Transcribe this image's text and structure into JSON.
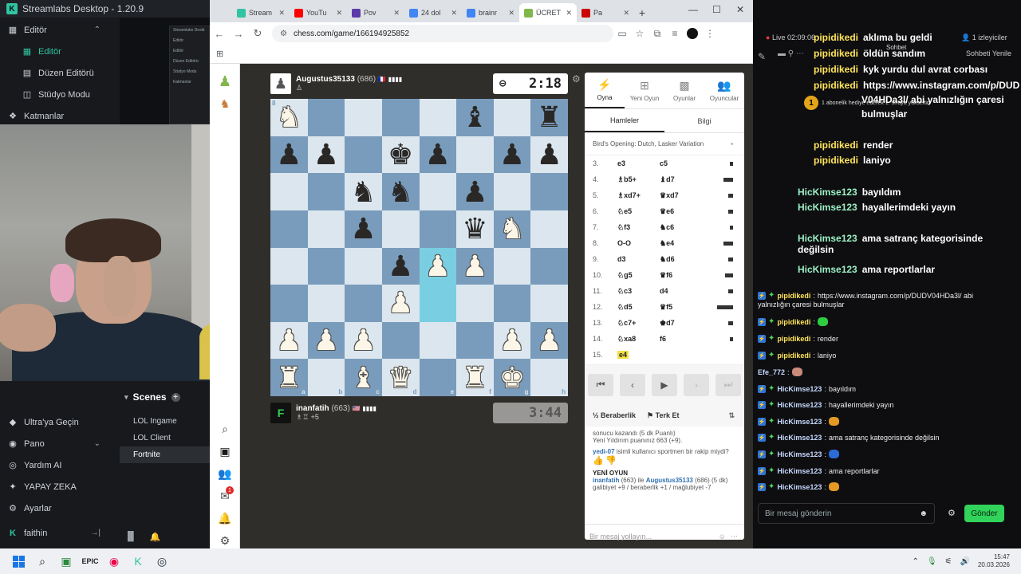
{
  "streamlabs": {
    "title": "Streamlabs Desktop - 1.20.9",
    "nav": [
      {
        "label": "Editör",
        "icon": "grid-icon",
        "section": true
      },
      {
        "label": "Editör",
        "icon": "editor-icon",
        "active": true
      },
      {
        "label": "Düzen Editörü",
        "icon": "layout-icon"
      },
      {
        "label": "Stüdyo Modu",
        "icon": "studio-icon"
      },
      {
        "label": "Katmanlar",
        "icon": "layers-icon",
        "section": true
      }
    ],
    "bottom_nav": [
      {
        "label": "Ultra'ya Geçin",
        "icon": "diamond-icon"
      },
      {
        "label": "Pano",
        "icon": "dashboard-icon"
      },
      {
        "label": "Yardım AI",
        "icon": "help-icon"
      },
      {
        "label": "YAPAY ZEKA",
        "icon": "ai-icon"
      },
      {
        "label": "Ayarlar",
        "icon": "gear-icon"
      },
      {
        "label": "faithin",
        "icon": "user-icon"
      }
    ],
    "mini_editor": [
      "Streamlabs Deskt",
      "Editör",
      "Editör",
      "Düzen Editörü",
      "Stüdyo Modu",
      "Katmanlar"
    ],
    "scenes_title": "Scenes",
    "scenes": [
      "LOL Ingame",
      "LOL Client",
      "Fortnite"
    ],
    "selected_scene": "Fortnite"
  },
  "chrome": {
    "tabs": [
      {
        "title": "Stream",
        "color": "#31c3a2"
      },
      {
        "title": "YouTu",
        "color": "#ff0000"
      },
      {
        "title": "Pov",
        "color": "#5a3aa8"
      },
      {
        "title": "24 dol",
        "color": "#4285f4"
      },
      {
        "title": "brainr",
        "color": "#4285f4"
      },
      {
        "title": "ÜCRET",
        "color": "#81b64c",
        "active": true
      },
      {
        "title": "Pa",
        "color": "#c00"
      }
    ],
    "url": "chess.com/game/166194925852"
  },
  "chess": {
    "top_player": {
      "name": "Augustus35133",
      "rating": "(686)",
      "flag": "🇫🇷",
      "clock": "2:18"
    },
    "bottom_player": {
      "name": "inanfatih",
      "rating": "(663)",
      "flag": "🇺🇸",
      "material": "+5",
      "clock": "3:44"
    },
    "board": [
      [
        "wN",
        "",
        "",
        "",
        "",
        "bB",
        "",
        "bR"
      ],
      [
        "bP",
        "bP",
        "",
        "bK",
        "bP",
        "",
        "bP",
        "bP"
      ],
      [
        "",
        "",
        "bN",
        "bN",
        "",
        "bP",
        "",
        ""
      ],
      [
        "",
        "",
        "bP",
        "",
        "",
        "bQ",
        "wN",
        ""
      ],
      [
        "",
        "",
        "",
        "bP",
        "wP",
        "wP",
        "",
        ""
      ],
      [
        "",
        "",
        "",
        "wP",
        "",
        "",
        "",
        ""
      ],
      [
        "wP",
        "wP",
        "wP",
        "",
        "",
        "",
        "wP",
        "wP"
      ],
      [
        "wR",
        "",
        "wB",
        "wQ",
        "",
        "wR",
        "wK",
        ""
      ]
    ],
    "highlight": [
      [
        4,
        4
      ],
      [
        5,
        4
      ]
    ],
    "files": [
      "a",
      "b",
      "c",
      "d",
      "e",
      "f",
      "g",
      "h"
    ],
    "rank_label": "8",
    "side_tabs": [
      {
        "label": "Oyna",
        "icon": "bolt-icon",
        "active": true
      },
      {
        "label": "Yeni Oyun",
        "icon": "plus-icon"
      },
      {
        "label": "Oyunlar",
        "icon": "board-icon"
      },
      {
        "label": "Oyuncular",
        "icon": "players-icon"
      }
    ],
    "sub_tabs": [
      "Hamleler",
      "Bilgi"
    ],
    "opening": "Bird's Opening: Dutch, Lasker Variation",
    "moves": [
      {
        "n": "3.",
        "w": "e3",
        "b": "c5",
        "bar": 4
      },
      {
        "n": "4.",
        "w": "♗b5+",
        "b": "♝d7",
        "bar": 12
      },
      {
        "n": "5.",
        "w": "♗xd7+",
        "b": "♛xd7",
        "bar": 6
      },
      {
        "n": "6.",
        "w": "♘e5",
        "b": "♛e6",
        "bar": 6
      },
      {
        "n": "7.",
        "w": "♘f3",
        "b": "♞c6",
        "bar": 4
      },
      {
        "n": "8.",
        "w": "O-O",
        "b": "♞e4",
        "bar": 12
      },
      {
        "n": "9.",
        "w": "d3",
        "b": "♞d6",
        "bar": 6
      },
      {
        "n": "10.",
        "w": "♘g5",
        "b": "♛f6",
        "bar": 10
      },
      {
        "n": "11.",
        "w": "♘c3",
        "b": "d4",
        "bar": 6
      },
      {
        "n": "12.",
        "w": "♘d5",
        "b": "♛f5",
        "bar": 20
      },
      {
        "n": "13.",
        "w": "♘c7+",
        "b": "♚d7",
        "bar": 6
      },
      {
        "n": "14.",
        "w": "♘xa8",
        "b": "f6",
        "bar": 4
      },
      {
        "n": "15.",
        "w": "e4",
        "b": "",
        "bar": 0
      }
    ],
    "actions": {
      "draw": "Beraberlik",
      "resign": "Terk Et"
    },
    "chat_log": {
      "line1": "sonucu kazandı (5 dk Puanlı)",
      "line2": "Yeni Yıldırım puanınız 663 (+9).",
      "sportsman_user": "yedi-07",
      "sportsman_text": "isimli kullanıcı sportmen bir rakip miydi?",
      "new_game": "YENİ OYUN",
      "ng_p1": "inanfatih",
      "ng_mid": "(663) ile",
      "ng_p2": "Augustus35133",
      "ng_tail": "(686) (5 dk)",
      "record": "galibiyet +9 / beraberlik +1 / mağlubiyet -7"
    },
    "chat_placeholder": "Bir mesaj yollayın..."
  },
  "stream_chat": {
    "live": "Live 02:09:06",
    "viewers": "1 izleyiciler",
    "chat_title": "Sohbet",
    "refresh": "Sohbeti Yenile",
    "sub_banner": "1 abonelik hediye ederek 1. sıraya yükseltin",
    "big_msgs": [
      {
        "name": "pipidikedi",
        "text": "aklıma bu geldi"
      },
      {
        "name": "pipidikedi",
        "text": "öldün sandım"
      },
      {
        "name": "pipidikedi",
        "text": "kyk yurdu dul avrat corbası"
      },
      {
        "name": "pipidikedi",
        "text": "https://www.instagram.com/p/DUD"
      },
      {
        "name": "",
        "text": "V04HDa3l/ abi yalnızlığın çaresi"
      },
      {
        "name": "",
        "text": "bulmuşlar"
      }
    ],
    "overlay_msgs": [
      {
        "name": "pipidikedi",
        "text": "render"
      },
      {
        "name": "pipidikedi",
        "text": "laniyo"
      },
      {
        "name": "HicKimse123",
        "text": "bayıldım"
      },
      {
        "name": "HicKimse123",
        "text": "hayallerimdeki yayın"
      },
      {
        "name": "HicKimse123",
        "text": "ama satranç kategorisinde değilsin"
      },
      {
        "name": "HicKimse123",
        "text": "ama reportlarlar"
      }
    ],
    "messages": [
      {
        "name": "pipidikedi",
        "text": "https://www.instagram.com/p/DUDV04HDa3l/ abi"
      },
      {
        "name": "",
        "text": "yalnızlığın çaresi bulmuşlar"
      },
      {
        "name": "pipidikedi",
        "text": ""
      },
      {
        "name": "pipidikedi",
        "text": "render"
      },
      {
        "name": "pipidikedi",
        "text": "laniyo"
      },
      {
        "name": "Efe_772",
        "text": ""
      },
      {
        "name": "HicKimse123",
        "text": "bayıldım"
      },
      {
        "name": "HicKimse123",
        "text": "hayallerimdeki yayın"
      },
      {
        "name": "HicKimse123",
        "text": ""
      },
      {
        "name": "HicKimse123",
        "text": "ama satranç kategorisinde değilsin"
      },
      {
        "name": "HicKimse123",
        "text": ""
      },
      {
        "name": "HicKimse123",
        "text": "ama reportlarlar"
      },
      {
        "name": "HicKimse123",
        "text": ""
      }
    ],
    "input_placeholder": "Bir mesaj gönderin",
    "send": "Gönder"
  },
  "taskbar": {
    "time": "15:47",
    "date": "20.03.2026"
  }
}
